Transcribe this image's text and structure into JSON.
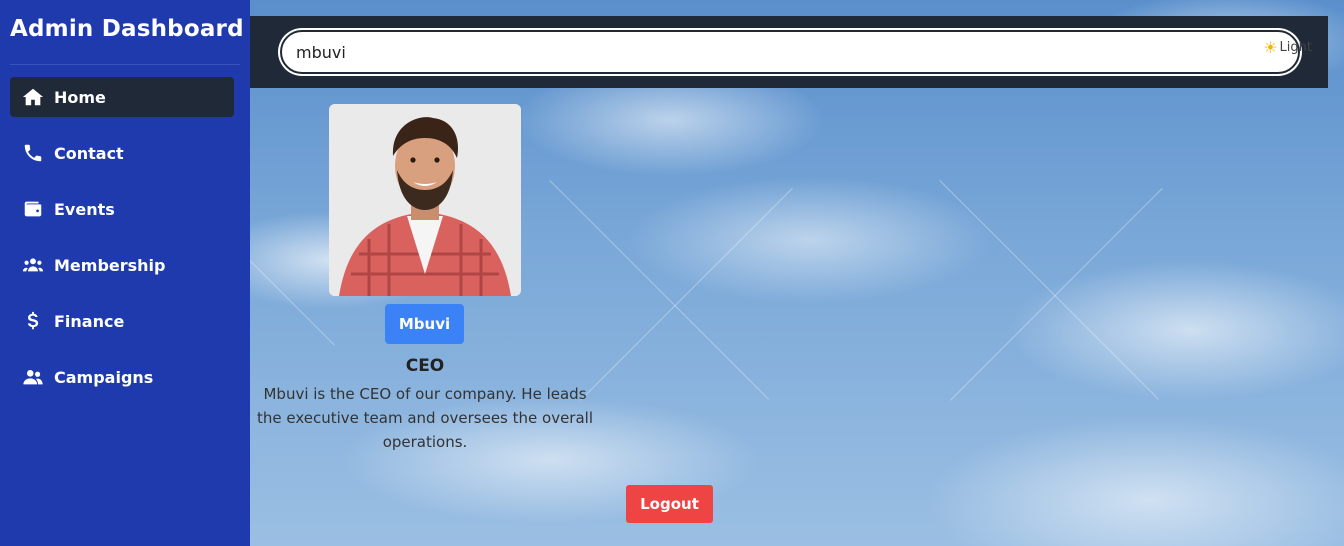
{
  "sidebar": {
    "title": "Admin Dashboard",
    "items": [
      {
        "label": "Home",
        "icon": "home-icon",
        "active": true
      },
      {
        "label": "Contact",
        "icon": "phone-icon",
        "active": false
      },
      {
        "label": "Events",
        "icon": "wallet-icon",
        "active": false
      },
      {
        "label": "Membership",
        "icon": "users-icon",
        "active": false
      },
      {
        "label": "Finance",
        "icon": "dollar-icon",
        "active": false
      },
      {
        "label": "Campaigns",
        "icon": "user-group-icon",
        "active": false
      }
    ]
  },
  "topbar": {
    "search_value": "mbuvi",
    "theme_label": "Light",
    "theme_icon": "sun-icon"
  },
  "profile": {
    "name": "Mbuvi",
    "role": "CEO",
    "bio": "Mbuvi is the CEO of our company. He leads the executive team and oversees the overall operations."
  },
  "logout_label": "Logout",
  "colors": {
    "sidebar": "#1e3aad",
    "active_item": "#1f2937",
    "topbar": "#1f2937",
    "name_button": "#3b82f6",
    "logout_button": "#ef4444"
  }
}
